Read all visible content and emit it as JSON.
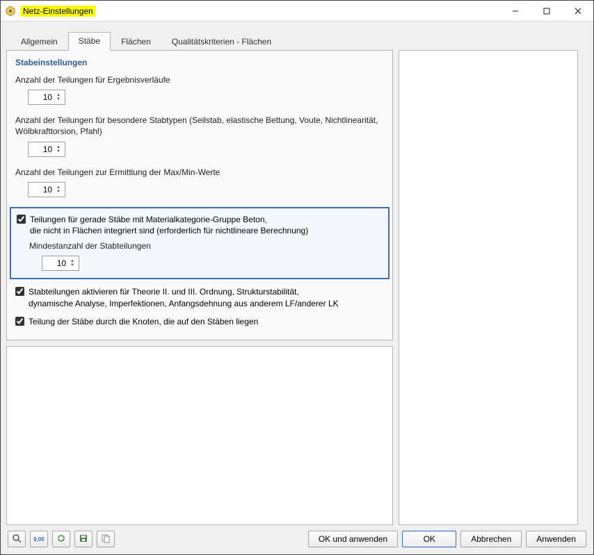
{
  "window": {
    "title": "Netz-Einstellungen"
  },
  "tabs": {
    "t0": "Allgemein",
    "t1": "Stäbe",
    "t2": "Flächen",
    "t3": "Qualitätskriterien - Flächen",
    "active_index": 1
  },
  "section": {
    "title": "Stabeinstellungen",
    "field1_label": "Anzahl der Teilungen für Ergebnisverläufe",
    "field1_value": "10",
    "field2_label": "Anzahl der Teilungen für besondere Stabtypen (Seilstab, elastische Bettung, Voute, Nichtlinearität, Wölbkrafttorsion, Pfahl)",
    "field2_value": "10",
    "field3_label": "Anzahl der Teilungen zur Ermittlung der Max/Min-Werte",
    "field3_value": "10",
    "chk1_label": "Teilungen für gerade Stäbe mit Materialkategorie-Gruppe Beton,\ndie nicht in Flächen integriert sind (erforderlich für nichtlineare Berechnung)",
    "chk1_checked": true,
    "chk1_sub_label": "Mindestanzahl der Stabteilungen",
    "chk1_sub_value": "10",
    "chk2_label": "Stabteilungen aktivieren für Theorie II. und III. Ordnung, Strukturstabilität,\ndynamische Analyse, Imperfektionen, Anfangsdehnung aus anderem LF/anderer LK",
    "chk2_checked": true,
    "chk3_label": "Teilung der Stäbe durch die Knoten, die auf den Stäben liegen",
    "chk3_checked": true
  },
  "footer": {
    "ok_apply": "OK und anwenden",
    "ok": "OK",
    "cancel": "Abbrechen",
    "apply": "Anwenden"
  }
}
